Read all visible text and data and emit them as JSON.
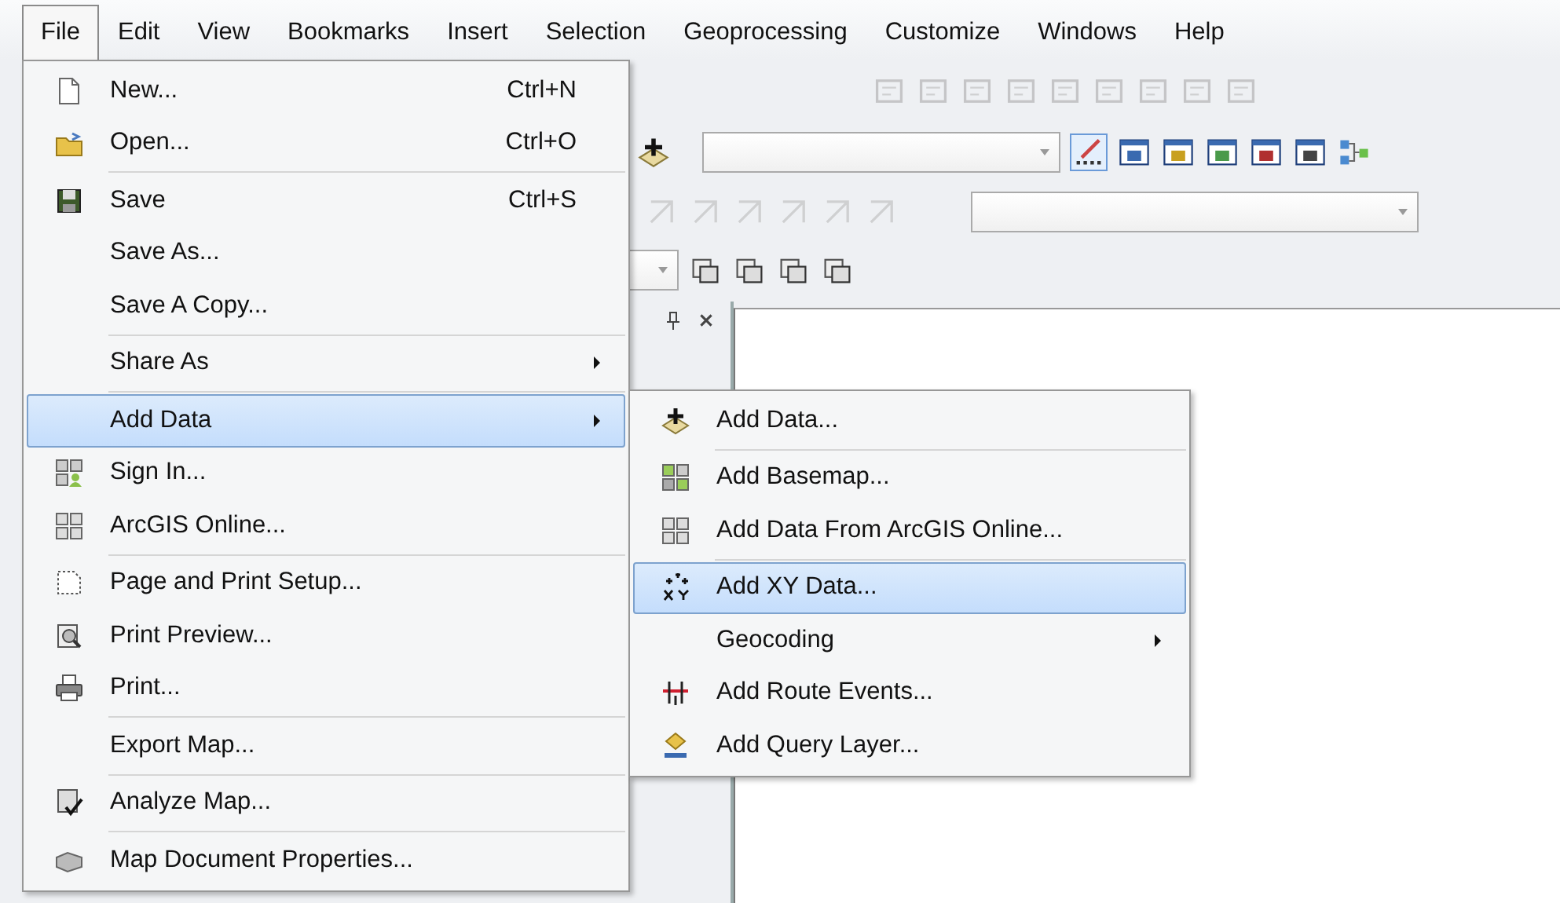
{
  "menubar": [
    {
      "label": "File",
      "selected": true
    },
    {
      "label": "Edit",
      "selected": false
    },
    {
      "label": "View",
      "selected": false
    },
    {
      "label": "Bookmarks",
      "selected": false
    },
    {
      "label": "Insert",
      "selected": false
    },
    {
      "label": "Selection",
      "selected": false
    },
    {
      "label": "Geoprocessing",
      "selected": false
    },
    {
      "label": "Customize",
      "selected": false
    },
    {
      "label": "Windows",
      "selected": false
    },
    {
      "label": "Help",
      "selected": false
    }
  ],
  "file_menu": {
    "groups": [
      [
        {
          "label": "New...",
          "shortcut": "Ctrl+N",
          "has_submenu": false,
          "selected": false
        },
        {
          "label": "Open...",
          "shortcut": "Ctrl+O",
          "has_submenu": false,
          "selected": false
        }
      ],
      [
        {
          "label": "Save",
          "shortcut": "Ctrl+S",
          "has_submenu": false,
          "selected": false
        },
        {
          "label": "Save As...",
          "has_submenu": false,
          "selected": false
        },
        {
          "label": "Save A Copy...",
          "has_submenu": false,
          "selected": false
        }
      ],
      [
        {
          "label": "Share As",
          "has_submenu": true,
          "selected": false
        }
      ],
      [
        {
          "label": "Add Data",
          "has_submenu": true,
          "selected": true
        },
        {
          "label": "Sign In...",
          "has_submenu": false,
          "selected": false
        },
        {
          "label": "ArcGIS Online...",
          "has_submenu": false,
          "selected": false
        }
      ],
      [
        {
          "label": "Page and Print Setup...",
          "has_submenu": false,
          "selected": false
        },
        {
          "label": "Print Preview...",
          "has_submenu": false,
          "selected": false
        },
        {
          "label": "Print...",
          "has_submenu": false,
          "selected": false
        }
      ],
      [
        {
          "label": "Export Map...",
          "has_submenu": false,
          "selected": false
        }
      ],
      [
        {
          "label": "Analyze Map...",
          "has_submenu": false,
          "selected": false
        }
      ],
      [
        {
          "label": "Map Document Properties...",
          "has_submenu": false,
          "selected": false
        }
      ]
    ]
  },
  "add_data_submenu": {
    "groups": [
      [
        {
          "label": "Add Data...",
          "has_submenu": false,
          "selected": false
        }
      ],
      [
        {
          "label": "Add Basemap...",
          "has_submenu": false,
          "selected": false
        },
        {
          "label": "Add Data From ArcGIS Online...",
          "has_submenu": false,
          "selected": false
        }
      ],
      [
        {
          "label": "Add XY Data...",
          "has_submenu": false,
          "selected": true
        },
        {
          "label": "Geocoding",
          "has_submenu": true,
          "selected": false
        },
        {
          "label": "Add Route Events...",
          "has_submenu": false,
          "selected": false
        },
        {
          "label": "Add Query Layer...",
          "has_submenu": false,
          "selected": false
        }
      ]
    ]
  }
}
